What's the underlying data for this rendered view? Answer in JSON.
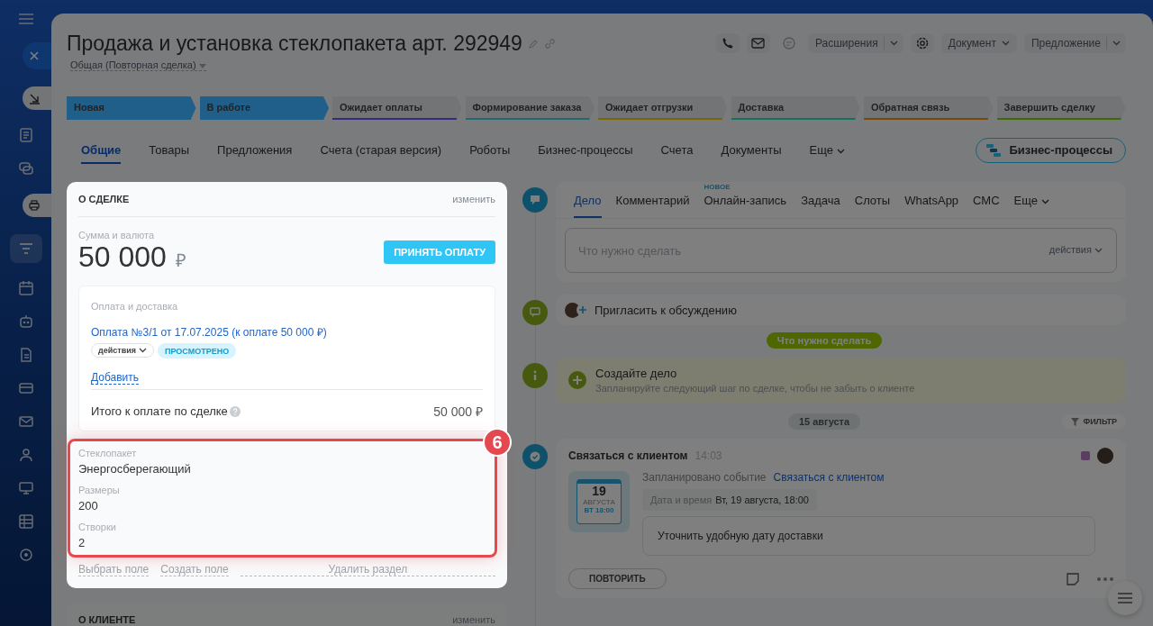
{
  "header": {
    "title": "Продажа и установка стеклопакета арт. 292949",
    "category": "Общая (Повторная сделка)"
  },
  "toolbar": {
    "extensions": "Расширения",
    "document": "Документ",
    "proposal": "Предложение"
  },
  "stages": [
    {
      "label": "Новая",
      "color": "#1f5f8a",
      "reached": true
    },
    {
      "label": "В работе",
      "color": "#1f5f8a",
      "reached": true
    },
    {
      "label": "Ожидает оплаты",
      "color": "#3b2680",
      "reached": false
    },
    {
      "label": "Формирование заказа",
      "color": "#1f6a72",
      "reached": false
    },
    {
      "label": "Ожидает отгрузки",
      "color": "#7a6500",
      "reached": false
    },
    {
      "label": "Доставка",
      "color": "#127060",
      "reached": false
    },
    {
      "label": "Обратная связь",
      "color": "#7a4708",
      "reached": false
    },
    {
      "label": "Завершить сделку",
      "color": "#3e6b00",
      "reached": false
    }
  ],
  "tabs": [
    {
      "label": "Общие",
      "selected": true
    },
    {
      "label": "Товары",
      "selected": false
    },
    {
      "label": "Предложения",
      "selected": false
    },
    {
      "label": "Счета (старая версия)",
      "selected": false
    },
    {
      "label": "Роботы",
      "selected": false
    },
    {
      "label": "Бизнес-процессы",
      "selected": false
    },
    {
      "label": "Счета",
      "selected": false
    },
    {
      "label": "Документы",
      "selected": false
    }
  ],
  "more_tab": "Еще",
  "bp_button": "Бизнес-процессы",
  "deal_card": {
    "title": "О СДЕЛКЕ",
    "edit": "изменить",
    "amount_label": "Сумма и валюта",
    "amount": "50 000",
    "currency": "₽",
    "pay_button": "ПРИНЯТЬ ОПЛАТУ",
    "payment": {
      "title": "Оплата и доставка",
      "link": "Оплата №3/1 от 17.07.2025 (к оплате 50 000 ₽)",
      "actions": "действия",
      "status": "ПРОСМОТРЕНО",
      "add": "Добавить",
      "total_label": "Итого к оплате по сделке",
      "total": "50 000 ₽"
    },
    "fields": [
      {
        "label": "Стеклопакет",
        "value": "Энергосберегающий"
      },
      {
        "label": "Размеры",
        "value": "200"
      },
      {
        "label": "Створки",
        "value": "2"
      }
    ],
    "callout": "6",
    "links": [
      "Выбрать поле",
      "Создать поле"
    ],
    "delete_link": "Удалить раздел"
  },
  "client_card": {
    "title": "О КЛИЕНТЕ",
    "edit": "изменить"
  },
  "composer": {
    "tabs": [
      {
        "label": "Дело",
        "selected": true
      },
      {
        "label": "Комментарий",
        "selected": false
      },
      {
        "label": "Онлайн-запись",
        "selected": false,
        "badge": "НОВОЕ"
      },
      {
        "label": "Задача",
        "selected": false
      },
      {
        "label": "Слоты",
        "selected": false
      },
      {
        "label": "WhatsApp",
        "selected": false
      },
      {
        "label": "СМС",
        "selected": false
      }
    ],
    "more": "Еще",
    "placeholder": "Что нужно сделать",
    "actions": "действия"
  },
  "invite": "Пригласить к обсуждению",
  "todo_badge": "Что нужно сделать",
  "create": {
    "title": "Создайте дело",
    "hint": "Запланируйте следующий шаг по сделке, чтобы не забыть о клиенте"
  },
  "date": "15 августа",
  "filter": "ФИЛЬТР",
  "activity": {
    "title": "Связаться с клиентом",
    "time": "14:03",
    "color": "#5a3d63",
    "scheduled_label": "Запланировано событие",
    "link": "Связаться с клиентом",
    "datetime_label": "Дата и время",
    "datetime": "Вт, 19 августа, 18:00",
    "note": "Уточнить удобную дату доставки",
    "calendar": {
      "day": "19",
      "month": "АВГУСТА",
      "weekday": "ВТ 18:00"
    },
    "repeat": "ПОВТОРИТЬ"
  }
}
